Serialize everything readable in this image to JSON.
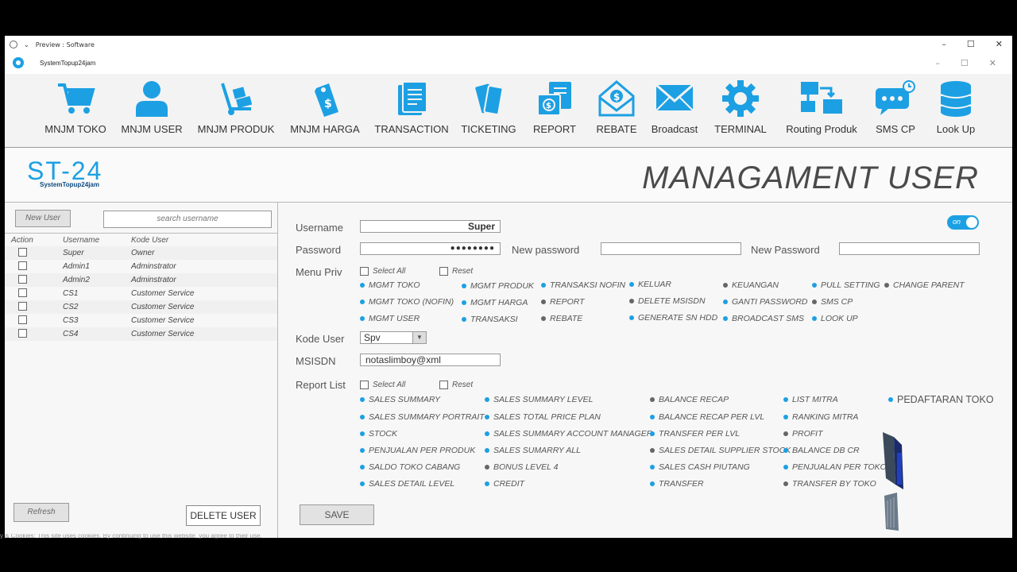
{
  "window": {
    "preview_title": "Preview : Software",
    "app_title": "SystemTopup24jam"
  },
  "toolbar": {
    "items": [
      {
        "label": "MNJM TOKO",
        "icon": "cart-icon"
      },
      {
        "label": "MNJM USER",
        "icon": "user-icon"
      },
      {
        "label": "MNJM PRODUK",
        "icon": "hand-truck-icon"
      },
      {
        "label": "MNJM HARGA",
        "icon": "price-tag-icon"
      },
      {
        "label": "TRANSACTION",
        "icon": "document-icon"
      },
      {
        "label": "TICKETING",
        "icon": "tickets-icon"
      },
      {
        "label": "REPORT",
        "icon": "money-report-icon"
      },
      {
        "label": "REBATE",
        "icon": "envelope-dollar-icon"
      },
      {
        "label": "Broadcast",
        "icon": "mail-icon"
      },
      {
        "label": "TERMINAL",
        "icon": "gear-icon"
      },
      {
        "label": "Routing Produk",
        "icon": "network-icon"
      },
      {
        "label": "SMS CP",
        "icon": "chat-icon"
      },
      {
        "label": "Look Up",
        "icon": "database-icon"
      }
    ]
  },
  "header": {
    "brand_big": "ST-24",
    "brand_small": "SystemTopup24jam",
    "page_title": "MANAGAMENT USER"
  },
  "left": {
    "new_user_label": "New User",
    "search_placeholder": "search username",
    "columns": {
      "action": "Action",
      "username": "Username",
      "kode": "Kode User"
    },
    "users": [
      {
        "username": "Super",
        "kode": "Owner"
      },
      {
        "username": "Admin1",
        "kode": "Adminstrator"
      },
      {
        "username": "Admin2",
        "kode": "Adminstrator"
      },
      {
        "username": "CS1",
        "kode": "Customer Service"
      },
      {
        "username": "CS2",
        "kode": "Customer Service"
      },
      {
        "username": "CS3",
        "kode": "Customer Service"
      },
      {
        "username": "CS4",
        "kode": "Customer Service"
      }
    ],
    "refresh_label": "Refresh",
    "delete_label": "DELETE USER"
  },
  "form": {
    "username_label": "Username",
    "username_value": "Super",
    "password_label": "Password",
    "password_value": "●●●●●●●●",
    "new_password_label_1": "New password",
    "new_password_label_2": "New Password",
    "toggle_label": "on",
    "menu_priv_label": "Menu Priv",
    "select_all": "Select All",
    "reset": "Reset",
    "kode_user_label": "Kode User",
    "kode_user_value": "Spv",
    "msisdn_label": "MSISDN",
    "msisdn_value": "notaslimboy@xml",
    "report_list_label": "Report List",
    "save_label": "SAVE"
  },
  "menu_priv": [
    {
      "label": "MGMT TOKO",
      "on": true
    },
    {
      "label": "MGMT TOKO (NOFIN)",
      "on": true
    },
    {
      "label": "MGMT USER",
      "on": true
    },
    {
      "label": "MGMT PRODUK",
      "on": true
    },
    {
      "label": "MGMT HARGA",
      "on": true
    },
    {
      "label": "TRANSAKSI",
      "on": true
    },
    {
      "label": "TRANSAKSI NOFIN",
      "on": true
    },
    {
      "label": "REPORT",
      "on": false
    },
    {
      "label": "REBATE",
      "on": false
    },
    {
      "label": "KELUAR",
      "on": true
    },
    {
      "label": "DELETE MSISDN",
      "on": false
    },
    {
      "label": "GENERATE SN HDD",
      "on": true
    },
    {
      "label": "KEUANGAN",
      "on": false
    },
    {
      "label": "GANTI PASSWORD",
      "on": true
    },
    {
      "label": "BROADCAST SMS",
      "on": true
    },
    {
      "label": "PULL SETTING",
      "on": true
    },
    {
      "label": "SMS CP",
      "on": false
    },
    {
      "label": "LOOK UP",
      "on": true
    },
    {
      "label": "CHANGE PARENT",
      "on": false
    }
  ],
  "report_list": [
    {
      "label": "SALES SUMMARY",
      "on": true
    },
    {
      "label": "SALES SUMMARY PORTRAIT",
      "on": true
    },
    {
      "label": "STOCK",
      "on": true
    },
    {
      "label": "PENJUALAN PER PRODUK",
      "on": true
    },
    {
      "label": "SALDO TOKO CABANG",
      "on": true
    },
    {
      "label": "SALES DETAIL LEVEL",
      "on": true
    },
    {
      "label": "SALES SUMMARY LEVEL",
      "on": true
    },
    {
      "label": "SALES TOTAL PRICE PLAN",
      "on": true
    },
    {
      "label": "SALES SUMMARY ACCOUNT MANAGER",
      "on": true
    },
    {
      "label": "SALES SUMARRY ALL",
      "on": true
    },
    {
      "label": "BONUS LEVEL 4",
      "on": false
    },
    {
      "label": "CREDIT",
      "on": true
    },
    {
      "label": "BALANCE RECAP",
      "on": false
    },
    {
      "label": "BALANCE RECAP PER LVL",
      "on": true
    },
    {
      "label": "TRANSFER PER LVL",
      "on": true
    },
    {
      "label": "SALES DETAIL SUPPLIER STOCK",
      "on": false
    },
    {
      "label": "SALES CASH PIUTANG",
      "on": true
    },
    {
      "label": "TRANSFER",
      "on": true
    },
    {
      "label": "LIST MITRA",
      "on": true
    },
    {
      "label": "RANKING MITRA",
      "on": true
    },
    {
      "label": "PROFIT",
      "on": false
    },
    {
      "label": "BALANCE DB CR",
      "on": true
    },
    {
      "label": "PENJUALAN PER TOKO",
      "on": true
    },
    {
      "label": "TRANSFER BY TOKO",
      "on": false
    },
    {
      "label": "PEDAFTARAN TOKO",
      "on": true
    }
  ],
  "cookie_text": "y & Cookies: This site uses cookies. By continuing to use this website, you agree to their use.",
  "colors": {
    "accent": "#1ca0e3",
    "dark_dot": "#666666"
  }
}
